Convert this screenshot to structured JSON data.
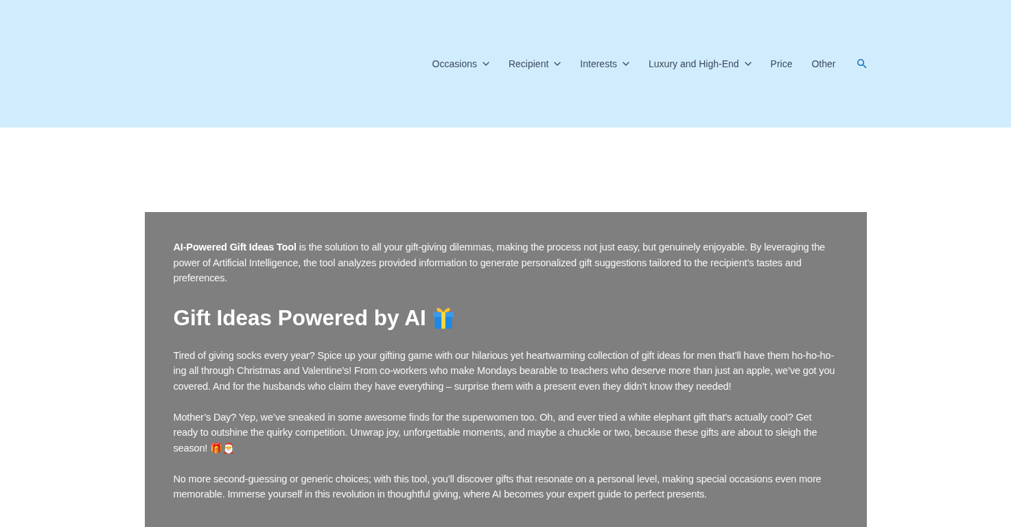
{
  "header": {
    "nav": [
      {
        "label": "Occasions",
        "kind": "dropdown"
      },
      {
        "label": "Recipient",
        "kind": "dropdown"
      },
      {
        "label": "Interests",
        "kind": "dropdown"
      },
      {
        "label": "Luxury and High-End",
        "kind": "dropdown"
      },
      {
        "label": "Price",
        "kind": "link"
      },
      {
        "label": "Other",
        "kind": "link"
      }
    ]
  },
  "content": {
    "intro": "**AI-Powered Gift Ideas Tool** is the solution to all your gift-giving dilemmas, making the process not just easy, but genuinely enjoyable. By leveraging the power of Artificial Intelligence, the tool analyzes provided information to generate personalized gift suggestions tailored to the recipient’s tastes and preferences.",
    "heading": "Gift Ideas Powered by AI",
    "paragraphs": [
      "Tired of giving socks every year? Spice up your gifting game with our hilarious yet heartwarming collection of gift ideas for men that’ll have them ho-ho-ho-ing all through Christmas and Valentine’s! From co-workers who make Mondays bearable to teachers who deserve more than just an apple, we’ve got you covered. And for the husbands who claim they have everything – surprise them with a present even they didn’t know they needed!",
      "Mother’s Day? Yep, we’ve sneaked in some awesome finds for the superwomen too. Oh, and ever tried a white elephant gift that’s actually cool? Get ready to outshine the quirky competition. Unwrap joy, unforgettable moments, and maybe a chuckle or two, because these gifts are about to sleigh the season! 🎁🎅",
      "No more second-guessing or generic choices; with this tool, you’ll discover gifts that resonate on a personal level, making special occasions even more memorable. Immerse yourself in this revolution in thoughtful giving, where AI becomes your expert guide to perfect presents."
    ]
  }
}
